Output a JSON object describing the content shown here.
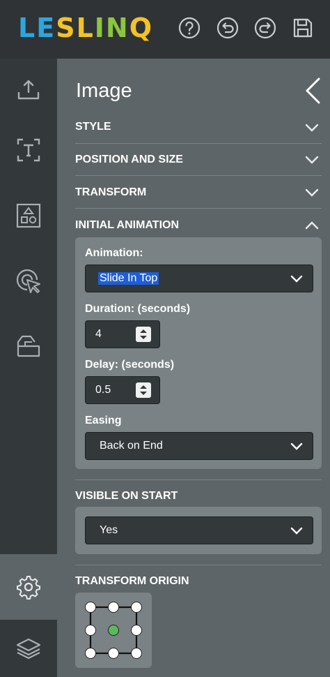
{
  "app": {
    "logo_text": "LESLINQ",
    "logo_colors": [
      "#2aa7e0",
      "#2aa7e0",
      "#f3c324",
      "#f3c324",
      "#8cc63f",
      "#8cc63f",
      "#f3c324"
    ]
  },
  "header": {
    "buttons": [
      {
        "name": "help-button",
        "icon": "help-circle-icon"
      },
      {
        "name": "undo-button",
        "icon": "undo-icon"
      },
      {
        "name": "redo-button",
        "icon": "redo-icon"
      },
      {
        "name": "save-button",
        "icon": "save-icon"
      }
    ]
  },
  "sidebar": {
    "items": [
      {
        "name": "upload",
        "icon": "upload-icon"
      },
      {
        "name": "text",
        "icon": "text-icon"
      },
      {
        "name": "shapes",
        "icon": "shapes-icon"
      },
      {
        "name": "interaction",
        "icon": "click-target-icon"
      },
      {
        "name": "media",
        "icon": "folder-image-icon"
      },
      {
        "name": "settings",
        "icon": "gear-icon",
        "active": true
      },
      {
        "name": "layers",
        "icon": "layers-icon"
      }
    ]
  },
  "panel": {
    "title": "Image",
    "sections": {
      "style": "STYLE",
      "position_size": "POSITION AND SIZE",
      "transform": "TRANSFORM",
      "initial_animation": "INITIAL ANIMATION",
      "visible_on_start": "VISIBLE ON START",
      "transform_origin": "TRANSFORM ORIGIN"
    },
    "animation": {
      "animation_label": "Animation:",
      "animation_value": "Slide In Top",
      "duration_label": "Duration: (seconds)",
      "duration_value": "4",
      "delay_label": "Delay: (seconds)",
      "delay_value": "0.5",
      "easing_label": "Easing",
      "easing_value": "Back on End"
    },
    "visible": {
      "value": "Yes"
    },
    "origin": {
      "selected": "center",
      "selected_color": "#5cb85c"
    }
  }
}
